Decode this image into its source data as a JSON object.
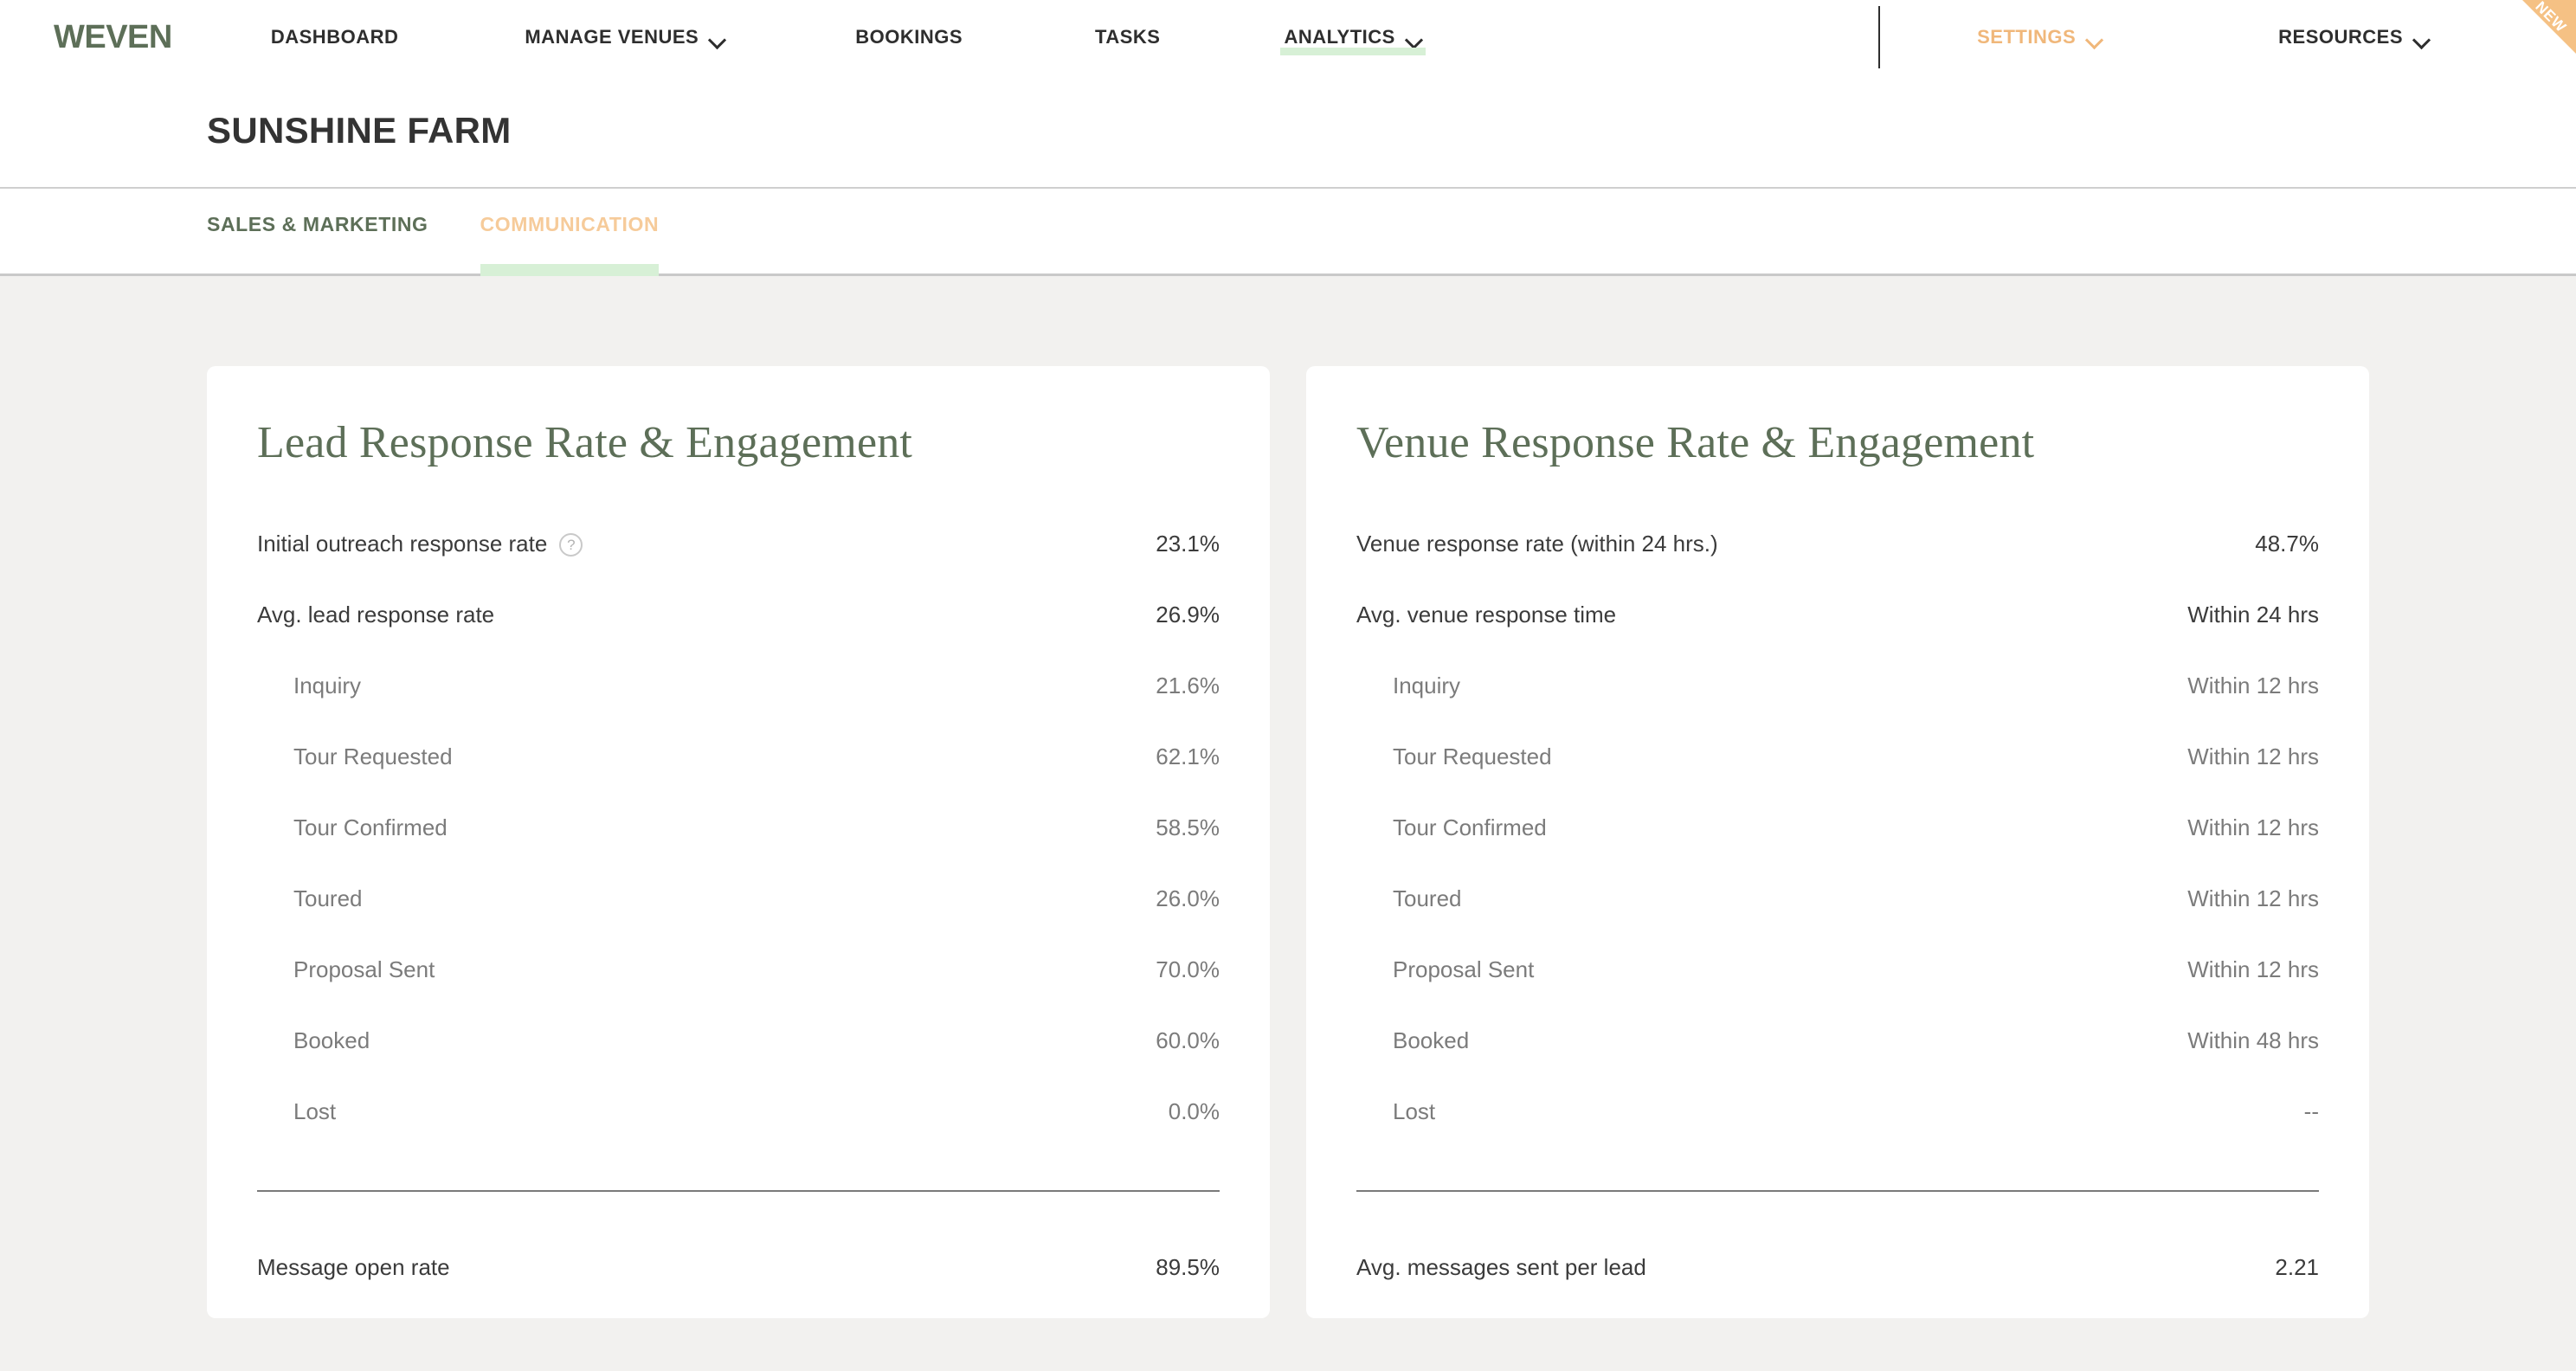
{
  "brand": {
    "logo": "WEVEN"
  },
  "nav": {
    "items": [
      {
        "label": "DASHBOARD",
        "has_chevron": false,
        "active": false,
        "style": "default"
      },
      {
        "label": "MANAGE VENUES",
        "has_chevron": true,
        "active": false,
        "style": "default"
      },
      {
        "label": "BOOKINGS",
        "has_chevron": false,
        "active": false,
        "style": "default"
      },
      {
        "label": "TASKS",
        "has_chevron": false,
        "active": false,
        "style": "default"
      },
      {
        "label": "ANALYTICS",
        "has_chevron": true,
        "active": true,
        "style": "default"
      }
    ],
    "right_items": [
      {
        "label": "SETTINGS",
        "has_chevron": true,
        "badge": "NEW",
        "style": "accent"
      },
      {
        "label": "RESOURCES",
        "has_chevron": true,
        "badge": null,
        "style": "default"
      }
    ]
  },
  "header": {
    "title": "SUNSHINE FARM"
  },
  "subtabs": [
    {
      "label": "SALES & MARKETING",
      "active": false
    },
    {
      "label": "COMMUNICATION",
      "active": true
    }
  ],
  "cards": {
    "lead": {
      "title": "Lead Response Rate & Engagement",
      "primary_rows": [
        {
          "label": "Initial outreach response rate",
          "value": "23.1%",
          "help": "?"
        },
        {
          "label": "Avg. lead response rate",
          "value": "26.9%",
          "help": null
        }
      ],
      "sub_rows": [
        {
          "label": "Inquiry",
          "value": "21.6%"
        },
        {
          "label": "Tour Requested",
          "value": "62.1%"
        },
        {
          "label": "Tour Confirmed",
          "value": "58.5%"
        },
        {
          "label": "Toured",
          "value": "26.0%"
        },
        {
          "label": "Proposal Sent",
          "value": "70.0%"
        },
        {
          "label": "Booked",
          "value": "60.0%"
        },
        {
          "label": "Lost",
          "value": "0.0%"
        }
      ],
      "footer_row": {
        "label": "Message open rate",
        "value": "89.5%"
      }
    },
    "venue": {
      "title": "Venue Response Rate & Engagement",
      "primary_rows": [
        {
          "label": "Venue response rate (within 24 hrs.)",
          "value": "48.7%",
          "help": null
        },
        {
          "label": "Avg. venue response time",
          "value": "Within 24 hrs",
          "help": null
        }
      ],
      "sub_rows": [
        {
          "label": "Inquiry",
          "value": "Within 12 hrs"
        },
        {
          "label": "Tour Requested",
          "value": "Within 12 hrs"
        },
        {
          "label": "Tour Confirmed",
          "value": "Within 12 hrs"
        },
        {
          "label": "Toured",
          "value": "Within 12 hrs"
        },
        {
          "label": "Proposal Sent",
          "value": "Within 12 hrs"
        },
        {
          "label": "Booked",
          "value": "Within 48 hrs"
        },
        {
          "label": "Lost",
          "value": "--"
        }
      ],
      "footer_row": {
        "label": "Avg. messages sent per lead",
        "value": "2.21"
      }
    }
  },
  "colors": {
    "brand_green": "#5d6f58",
    "accent_orange": "#f0b77a",
    "tab_active": "#f6cb9a",
    "underline_green": "#d7f0d6",
    "page_bg": "#f2f1ef",
    "card_bg": "#ffffff",
    "ribbon": "#f5c184"
  }
}
